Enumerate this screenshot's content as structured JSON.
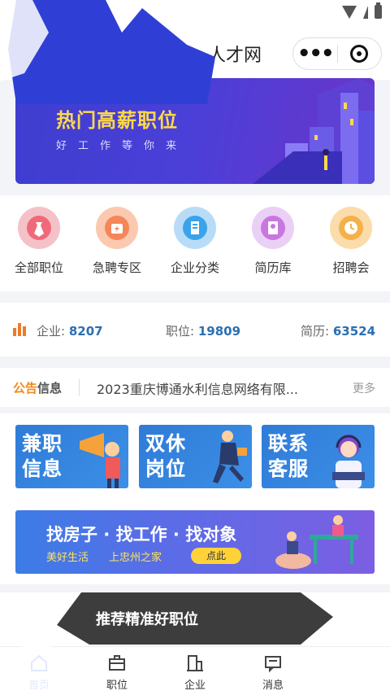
{
  "header": {
    "title": "人才网"
  },
  "banner": {
    "title": "热门高薪职位",
    "subtitle": "好工作等你来"
  },
  "nav": [
    {
      "label": "全部职位",
      "color": "#f0697a",
      "icon": "tie-icon"
    },
    {
      "label": "急聘专区",
      "color": "#f5865a",
      "icon": "urgent-bag-icon"
    },
    {
      "label": "企业分类",
      "color": "#3aa3ea",
      "icon": "building-icon"
    },
    {
      "label": "简历库",
      "color": "#c977e0",
      "icon": "resume-icon"
    },
    {
      "label": "招聘会",
      "color": "#f6b04a",
      "icon": "clock-icon"
    }
  ],
  "stats": {
    "company_label": "企业:",
    "company_value": "8207",
    "job_label": "职位:",
    "job_value": "19809",
    "resume_label": "简历:",
    "resume_value": "63524"
  },
  "notice": {
    "tag_a": "公告",
    "tag_b": "信息",
    "text": "2023重庆博通水利信息网络有限...",
    "more": "更多"
  },
  "cards": [
    {
      "line1": "兼职",
      "line2": "信息"
    },
    {
      "line1": "双休",
      "line2": "岗位"
    },
    {
      "line1": "联系",
      "line2": "客服"
    }
  ],
  "promo": {
    "title": "找房子 · 找工作 · 找对象",
    "sub1": "美好生活",
    "sub2": "上忠州之家",
    "button": "点此"
  },
  "recommend": {
    "title": "推荐精准好职位"
  },
  "tabs": [
    {
      "label": "首页",
      "icon": "home-icon"
    },
    {
      "label": "职位",
      "icon": "briefcase-icon"
    },
    {
      "label": "企业",
      "icon": "building-icon"
    },
    {
      "label": "消息",
      "icon": "message-icon"
    },
    {
      "label": "",
      "icon": ""
    }
  ],
  "colors": {
    "accent": "#2a6fb2",
    "orange": "#f08a1a",
    "banner_title": "#ffd94a"
  }
}
